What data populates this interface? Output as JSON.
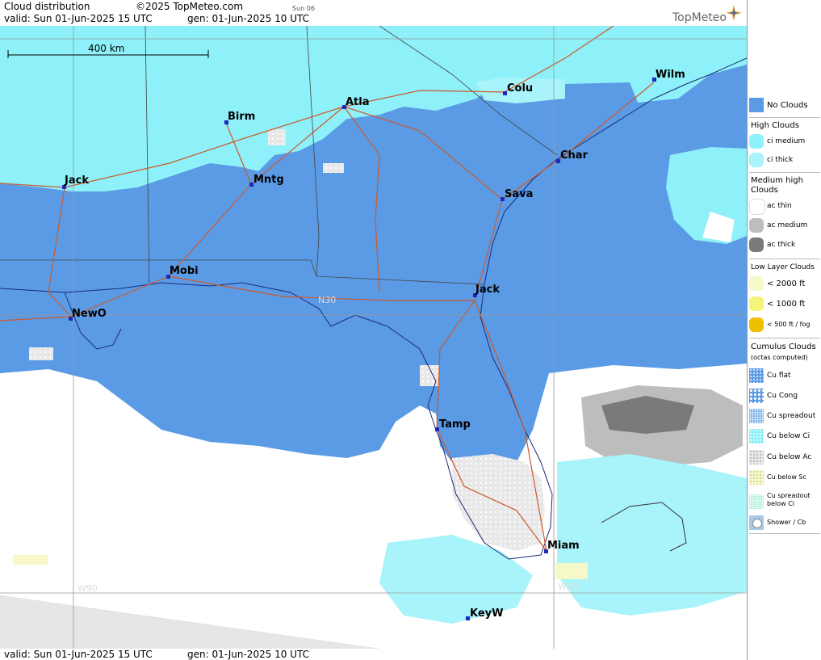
{
  "header": {
    "title": "Cloud distribution",
    "copyright": "©2025 TopMeteo.com",
    "day_small": "Sun 06",
    "valid": "valid:  Sun  01-Jun-2025  15 UTC",
    "generated": "gen:  01-Jun-2025 10 UTC",
    "logo": "TopMeteo"
  },
  "footer": {
    "valid": "valid:  Sun  01-Jun-2025  15 UTC",
    "generated": "gen:  01-Jun-2025 10 UTC"
  },
  "map": {
    "scale_label": "400 km",
    "grid_labels": [
      "N30",
      "W90",
      "W80"
    ],
    "cities": [
      {
        "name": "Birm"
      },
      {
        "name": "Atla"
      },
      {
        "name": "Colu"
      },
      {
        "name": "Wilm"
      },
      {
        "name": "Char"
      },
      {
        "name": "Jack"
      },
      {
        "name": "Mntg"
      },
      {
        "name": "Sava"
      },
      {
        "name": "Mobi"
      },
      {
        "name": "Jack"
      },
      {
        "name": "NewO"
      },
      {
        "name": "Tamp"
      },
      {
        "name": "Miam"
      },
      {
        "name": "KeyW"
      }
    ]
  },
  "legend": {
    "no_clouds": "No Clouds",
    "high_head": "High Clouds",
    "ci_medium": "ci medium",
    "ci_thick": "ci thick",
    "medium_head": "Medium high Clouds",
    "ac_thin": "ac thin",
    "ac_medium": "ac medium",
    "ac_thick": "ac thick",
    "low_head": "Low Layer Clouds",
    "low_2000": "< 2000 ft",
    "low_1000": "< 1000 ft",
    "low_500": "< 500 ft / fog",
    "cu_head": "Cumulus Clouds",
    "cu_sub": "(octas computed)",
    "cu_flat": "Cu flat",
    "cu_cong": "Cu Cong",
    "cu_spread": "Cu spreadout",
    "cu_below_ci": "Cu below Ci",
    "cu_below_ac": "Cu below Ac",
    "cu_below_sc": "Cu below Sc",
    "cu_spread_ci": "Cu spreadout below Ci",
    "shower": "Shower / Cb",
    "colors": {
      "no_clouds": "#5b9be6",
      "ci_medium": "#8ef0f8",
      "ci_thick": "#a8f4fa",
      "ac_thin": "#ffffff",
      "ac_medium": "#bdbdbd",
      "ac_thick": "#7a7a7a",
      "low_2000": "#f6f8c8",
      "low_1000": "#f4f47a",
      "low_500": "#f0c000"
    }
  }
}
